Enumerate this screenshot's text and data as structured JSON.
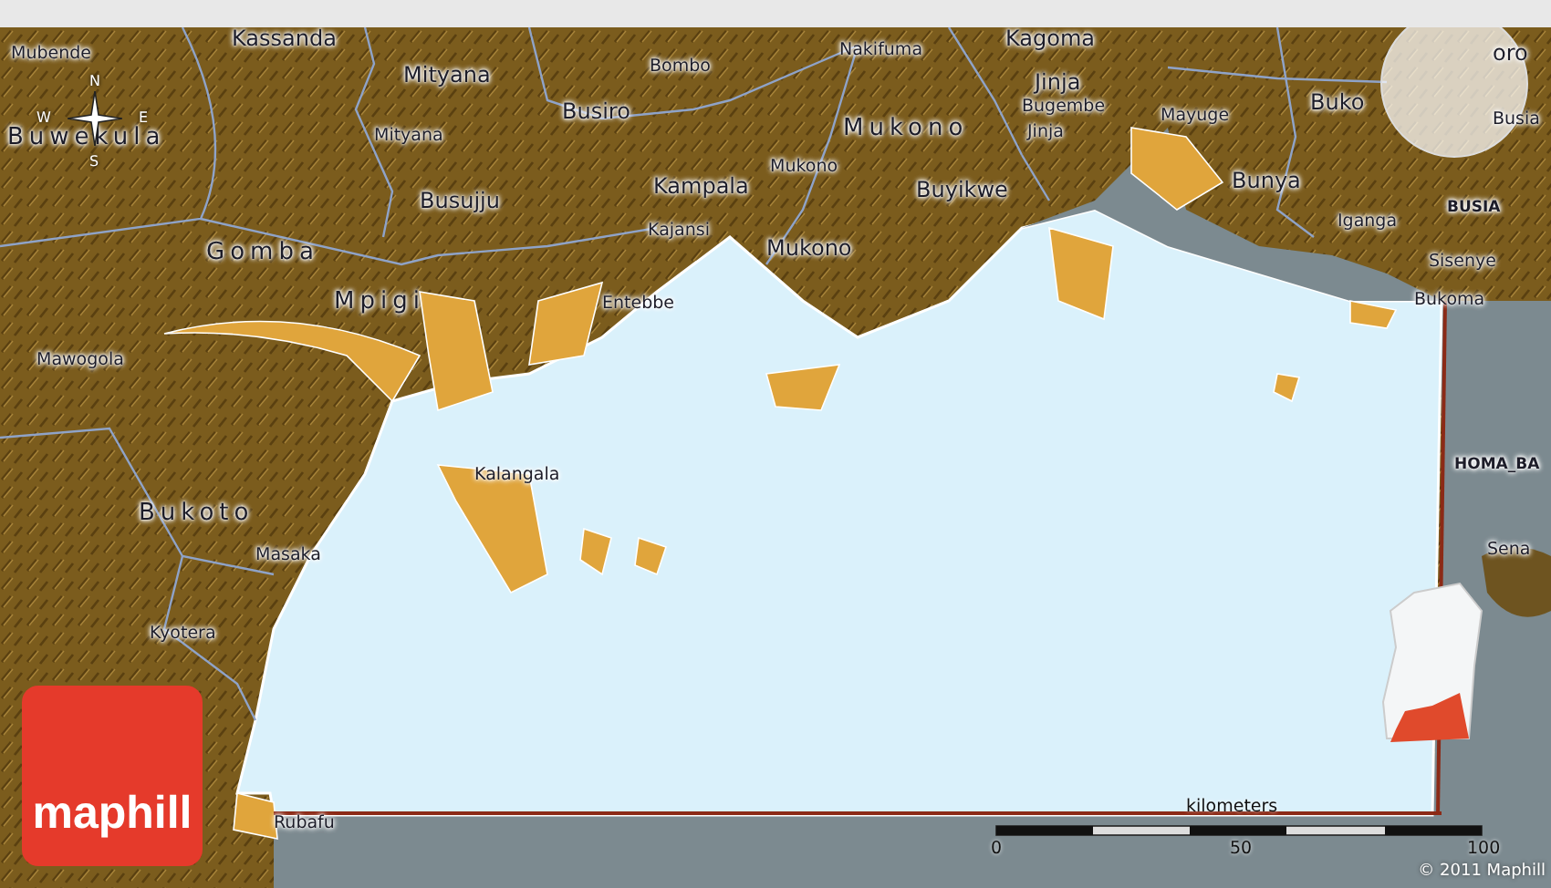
{
  "map": {
    "labels": [
      {
        "text": "Kassanda",
        "kind": "region"
      },
      {
        "text": "Mubende",
        "kind": "town"
      },
      {
        "text": "Buwekula",
        "kind": "county"
      },
      {
        "text": "Mityana",
        "kind": "region"
      },
      {
        "text": "Mityana",
        "kind": "town"
      },
      {
        "text": "Bombo",
        "kind": "town"
      },
      {
        "text": "Nakifuma",
        "kind": "town"
      },
      {
        "text": "Kagoma",
        "kind": "region"
      },
      {
        "text": "Jinja",
        "kind": "region"
      },
      {
        "text": "Bugembe",
        "kind": "town"
      },
      {
        "text": "Jinja",
        "kind": "town"
      },
      {
        "text": "Mayuge",
        "kind": "town"
      },
      {
        "text": "Buko",
        "kind": "region"
      },
      {
        "text": "oro",
        "kind": "region"
      },
      {
        "text": "Busia",
        "kind": "town"
      },
      {
        "text": "BUSIA",
        "kind": "foreign"
      },
      {
        "text": "Busiro",
        "kind": "region"
      },
      {
        "text": "Busujju",
        "kind": "region"
      },
      {
        "text": "Mukono",
        "kind": "county"
      },
      {
        "text": "Mukono",
        "kind": "town"
      },
      {
        "text": "Kampala",
        "kind": "region"
      },
      {
        "text": "Buyikwe",
        "kind": "region"
      },
      {
        "text": "Kajansi",
        "kind": "town"
      },
      {
        "text": "Mukono",
        "kind": "region"
      },
      {
        "text": "Bunya",
        "kind": "region"
      },
      {
        "text": "Iganga",
        "kind": "town"
      },
      {
        "text": "Gomba",
        "kind": "county"
      },
      {
        "text": "Mpigi",
        "kind": "county"
      },
      {
        "text": "Entebbe",
        "kind": "town"
      },
      {
        "text": "Sisenye",
        "kind": "town"
      },
      {
        "text": "Bukoma",
        "kind": "town"
      },
      {
        "text": "Mawogola",
        "kind": "town"
      },
      {
        "text": "HOMA_BA",
        "kind": "foreign"
      },
      {
        "text": "Kalangala",
        "kind": "town"
      },
      {
        "text": "Bukoto",
        "kind": "county"
      },
      {
        "text": "Masaka",
        "kind": "town"
      },
      {
        "text": "Sena",
        "kind": "town"
      },
      {
        "text": "Kyotera",
        "kind": "town"
      },
      {
        "text": "Rubafu",
        "kind": "town"
      }
    ],
    "compass": {
      "north": "N",
      "west": "W",
      "east": "E",
      "south": "S"
    }
  },
  "scale_bar": {
    "unit": "kilometers",
    "ticks": [
      "0",
      "50",
      "100"
    ]
  },
  "copyright": "© 2011 Maphill",
  "logo": {
    "text": "maphill"
  }
}
